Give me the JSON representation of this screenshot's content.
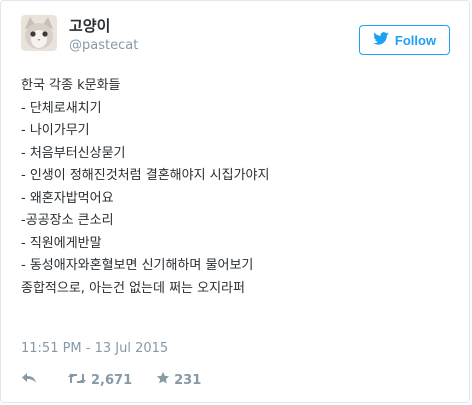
{
  "user": {
    "name": "고양이",
    "handle": "@pastecat"
  },
  "follow_button": {
    "label": "Follow",
    "color": "#1da1f2"
  },
  "tweet": {
    "lines": [
      "한국 각종 k문화들",
      "",
      "- 단체로새치기",
      "- 나이가무기",
      "- 처음부터신상묻기",
      "- 인생이 정해진것처럼 결혼해야지 시집가야지",
      "- 왜혼자밥먹어요",
      "-공공장소 큰소리",
      "- 직원에게반말",
      "- 동성애자와혼혈보면 신기해하며 물어보기",
      "",
      "종합적으로, 아는건 없는데 쩌는 오지라퍼"
    ],
    "timestamp": "11:51 PM - 13 Jul 2015"
  },
  "actions": {
    "reply_icon": "reply-icon",
    "retweet_icon": "retweet-icon",
    "retweet_count": "2,671",
    "like_icon": "star-icon",
    "like_count": "231"
  }
}
